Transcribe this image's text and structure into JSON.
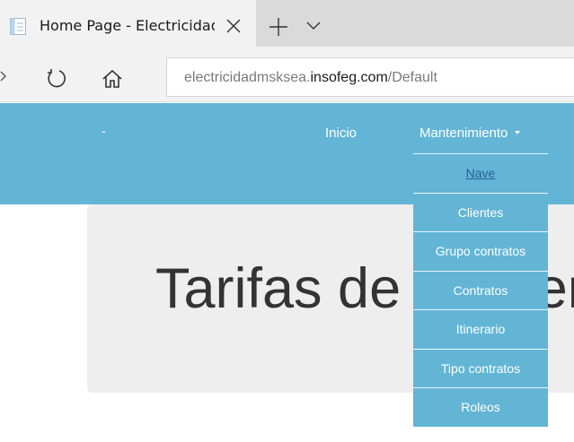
{
  "browser": {
    "tab": {
      "title": "Home Page - Electricidad"
    },
    "address": {
      "url_prefix": "electricidadmsksea.",
      "url_host": "insofeg.com",
      "url_path": "/Default"
    }
  },
  "site": {
    "brand": "-",
    "nav": {
      "inicio": "Inicio",
      "mantenimiento": "Mantenimiento"
    },
    "dropdown": {
      "items": [
        {
          "label": "Nave"
        },
        {
          "label": "Clientes"
        },
        {
          "label": "Grupo contratos"
        },
        {
          "label": "Contratos"
        },
        {
          "label": "Itinerario"
        },
        {
          "label": "Tipo contratos"
        },
        {
          "label": "Roleos"
        }
      ]
    },
    "jumbotron": {
      "title": "Tarifas de Conten"
    }
  },
  "colors": {
    "navbar": "#63b5d6",
    "jumbotron": "#eeeeee",
    "active_link": "#2b5f8c"
  }
}
